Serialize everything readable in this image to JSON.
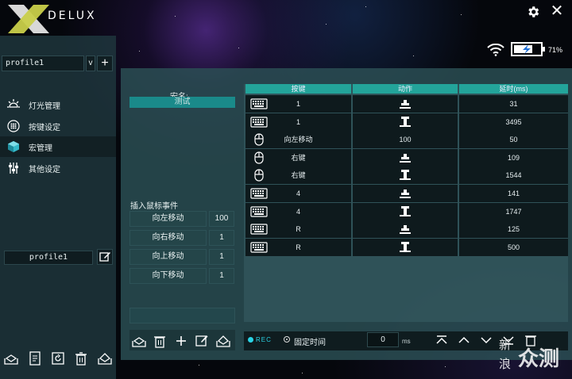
{
  "app": {
    "brand": "DELUX",
    "battery_percent": "71%",
    "battery_level": 0.71
  },
  "sidebar": {
    "profile_selected": "profile1",
    "profile_dropdown_glyph": "v",
    "profile_add_glyph": "+",
    "items": [
      {
        "label": "灯光管理",
        "icon": "sun-icon"
      },
      {
        "label": "按键设定",
        "icon": "keypad-icon"
      },
      {
        "label": "宏管理",
        "icon": "cube-icon"
      },
      {
        "label": "其他设定",
        "icon": "sliders-icon"
      }
    ],
    "active_index": 2,
    "profile_name": "profile1"
  },
  "macro": {
    "name_label": "宏名:",
    "name_value": "测试",
    "mouse_event_title": "插入鼠标事件",
    "mouse_events": [
      {
        "label": "向左移动",
        "value": "100"
      },
      {
        "label": "向右移动",
        "value": "1"
      },
      {
        "label": "向上移动",
        "value": "1"
      },
      {
        "label": "向下移动",
        "value": "1"
      }
    ]
  },
  "table": {
    "headers": [
      "按键",
      "动作",
      "延时(ms)"
    ],
    "rows": [
      {
        "device": "keyboard",
        "key": "1",
        "action": "press",
        "delay": "31"
      },
      {
        "device": "keyboard",
        "key": "1",
        "action": "release",
        "delay": "3495"
      },
      {
        "device": "mouse",
        "key": "向左移动",
        "action": "100",
        "delay": "50"
      },
      {
        "device": "mouse",
        "key": "右键",
        "action": "press",
        "delay": "109"
      },
      {
        "device": "mouse",
        "key": "右键",
        "action": "release",
        "delay": "1544"
      },
      {
        "device": "keyboard",
        "key": "4",
        "action": "press",
        "delay": "141"
      },
      {
        "device": "keyboard",
        "key": "4",
        "action": "release",
        "delay": "1747"
      },
      {
        "device": "keyboard",
        "key": "R",
        "action": "press",
        "delay": "125"
      },
      {
        "device": "keyboard",
        "key": "R",
        "action": "release",
        "delay": "500"
      }
    ]
  },
  "recorder": {
    "rec_label": "REC",
    "fixed_time_label": "固定时间",
    "ms_value": "0",
    "ms_unit": "ms"
  },
  "watermark": {
    "line1": "新",
    "line2": "浪",
    "word": "众测"
  },
  "colors": {
    "accent": "#23a49a",
    "rec": "#2ad4e6",
    "macro_name_bg": "#1a8a8a"
  }
}
